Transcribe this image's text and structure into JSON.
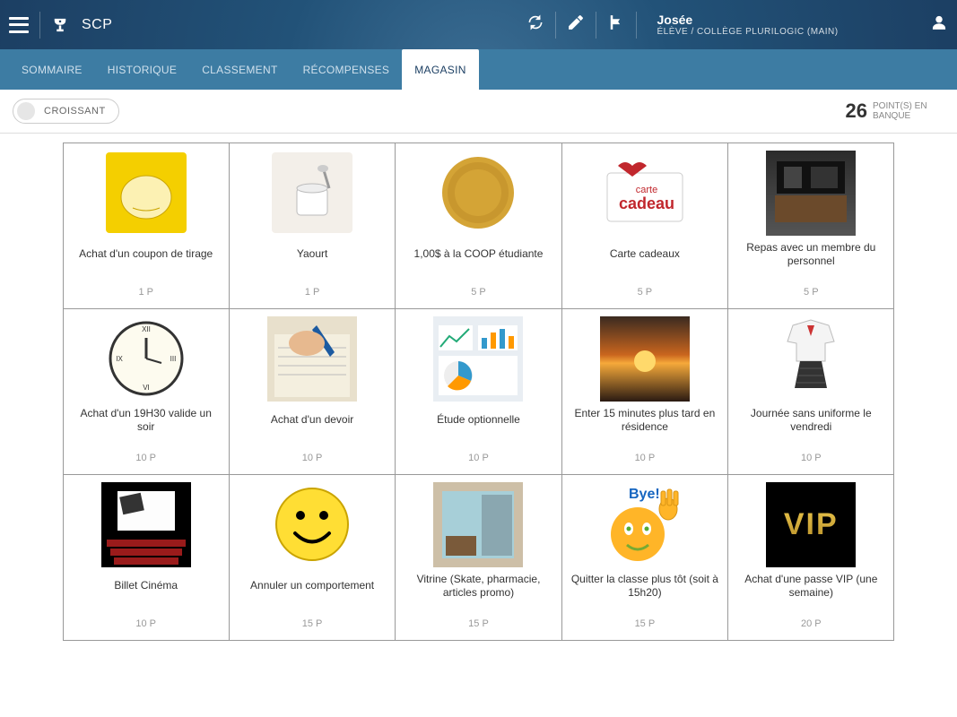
{
  "header": {
    "app_title": "SCP",
    "user_name": "Josée",
    "user_sub": "ÉLÈVE / COLLÈGE PLURILOGIC (MAIN)"
  },
  "tabs": [
    {
      "label": "SOMMAIRE",
      "active": false
    },
    {
      "label": "HISTORIQUE",
      "active": false
    },
    {
      "label": "CLASSEMENT",
      "active": false
    },
    {
      "label": "RÉCOMPENSES",
      "active": false
    },
    {
      "label": "MAGASIN",
      "active": true
    }
  ],
  "sort": {
    "label": "CROISSANT"
  },
  "points": {
    "value": "26",
    "label": "POINT(S) EN BANQUE"
  },
  "items": [
    {
      "title": "Achat d'un coupon de tirage",
      "price": "1 P",
      "icon": "fishbowl"
    },
    {
      "title": "Yaourt",
      "price": "1 P",
      "icon": "yogurt"
    },
    {
      "title": "1,00$ à la COOP étudiante",
      "price": "5 P",
      "icon": "coin"
    },
    {
      "title": "Carte cadeaux",
      "price": "5 P",
      "icon": "giftcard"
    },
    {
      "title": "Repas avec un membre du personnel",
      "price": "5 P",
      "icon": "restaurant"
    },
    {
      "title": "Achat d'un 19H30 valide un soir",
      "price": "10 P",
      "icon": "clock"
    },
    {
      "title": "Achat d'un devoir",
      "price": "10 P",
      "icon": "homework"
    },
    {
      "title": "Étude optionnelle",
      "price": "10 P",
      "icon": "charts"
    },
    {
      "title": "Enter 15 minutes plus tard en résidence",
      "price": "10 P",
      "icon": "sunset"
    },
    {
      "title": "Journée sans uniforme le vendredi",
      "price": "10 P",
      "icon": "uniform"
    },
    {
      "title": "Billet Cinéma",
      "price": "10 P",
      "icon": "cinema"
    },
    {
      "title": "Annuler un comportement",
      "price": "15 P",
      "icon": "smiley"
    },
    {
      "title": "Vitrine (Skate, pharmacie, articles promo)",
      "price": "15 P",
      "icon": "shop"
    },
    {
      "title": "Quitter la classe plus tôt (soit à 15h20)",
      "price": "15 P",
      "icon": "bye"
    },
    {
      "title": "Achat d'une passe VIP (une semaine)",
      "price": "20 P",
      "icon": "vip"
    }
  ]
}
